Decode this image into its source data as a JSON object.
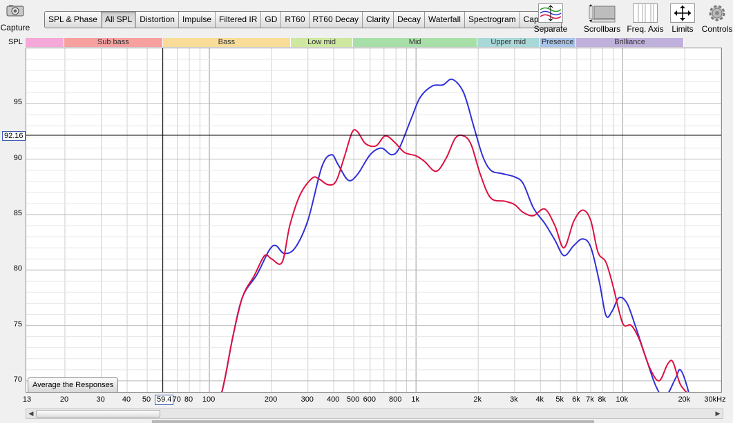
{
  "capture": {
    "label": "Capture",
    "icon": "camera-icon"
  },
  "tabs": [
    {
      "label": "SPL & Phase",
      "active": false
    },
    {
      "label": "All SPL",
      "active": true
    },
    {
      "label": "Distortion",
      "active": false
    },
    {
      "label": "Impulse",
      "active": false
    },
    {
      "label": "Filtered IR",
      "active": false
    },
    {
      "label": "GD",
      "active": false
    },
    {
      "label": "RT60",
      "active": false
    },
    {
      "label": "RT60 Decay",
      "active": false
    },
    {
      "label": "Clarity",
      "active": false
    },
    {
      "label": "Decay",
      "active": false
    },
    {
      "label": "Waterfall",
      "active": false
    },
    {
      "label": "Spectrogram",
      "active": false
    },
    {
      "label": "Captured",
      "active": false
    }
  ],
  "toolbar": {
    "separate": "Separate",
    "scrollbars": "Scrollbars",
    "freq_axis": "Freq. Axis",
    "limits": "Limits",
    "controls": "Controls"
  },
  "spl_label": "SPL",
  "bands": [
    {
      "label": "",
      "from": 13,
      "to": 20,
      "color": "#f6a8d8"
    },
    {
      "label": "Sub bass",
      "from": 20,
      "to": 60,
      "color": "#f6a0a0"
    },
    {
      "label": "Bass",
      "from": 60,
      "to": 250,
      "color": "#f8dc98"
    },
    {
      "label": "Low mid",
      "from": 250,
      "to": 500,
      "color": "#cfe8a0"
    },
    {
      "label": "Mid",
      "from": 500,
      "to": 2000,
      "color": "#a8dfa8"
    },
    {
      "label": "Upper mid",
      "from": 2000,
      "to": 4000,
      "color": "#a8d8d8"
    },
    {
      "label": "Presence",
      "from": 4000,
      "to": 6000,
      "color": "#a8c4e8"
    },
    {
      "label": "Brilliance",
      "from": 6000,
      "to": 20000,
      "color": "#c0b0dc"
    }
  ],
  "cursor": {
    "y_readout": "92.16",
    "x_readout": "59.4",
    "y_value": 92.16,
    "x_value": 59.4
  },
  "average_button": "Average the Responses",
  "chart_data": {
    "type": "line",
    "xscale": "log",
    "xlim": [
      13,
      30000
    ],
    "ylim": [
      69,
      100
    ],
    "yticks": [
      70,
      75,
      80,
      85,
      90,
      95
    ],
    "xticks": [
      {
        "v": 13,
        "label": "13"
      },
      {
        "v": 20,
        "label": "20"
      },
      {
        "v": 30,
        "label": "30"
      },
      {
        "v": 40,
        "label": "40"
      },
      {
        "v": 50,
        "label": "50"
      },
      {
        "v": 70,
        "label": "70"
      },
      {
        "v": 80,
        "label": "80"
      },
      {
        "v": 100,
        "label": "100"
      },
      {
        "v": 200,
        "label": "200"
      },
      {
        "v": 300,
        "label": "300"
      },
      {
        "v": 400,
        "label": "400"
      },
      {
        "v": 500,
        "label": "500"
      },
      {
        "v": 600,
        "label": "600"
      },
      {
        "v": 800,
        "label": "800"
      },
      {
        "v": 1000,
        "label": "1k"
      },
      {
        "v": 2000,
        "label": "2k"
      },
      {
        "v": 3000,
        "label": "3k"
      },
      {
        "v": 4000,
        "label": "4k"
      },
      {
        "v": 5000,
        "label": "5k"
      },
      {
        "v": 6000,
        "label": "6k"
      },
      {
        "v": 7000,
        "label": "7k"
      },
      {
        "v": 8000,
        "label": "8k"
      },
      {
        "v": 10000,
        "label": "10k"
      },
      {
        "v": 20000,
        "label": "20k"
      },
      {
        "v": 30000,
        "label": "30kHz"
      }
    ],
    "grid": true,
    "series": [
      {
        "color": "#3030d8",
        "points": [
          [
            100,
            66
          ],
          [
            115,
            69
          ],
          [
            130,
            74
          ],
          [
            145,
            77.6
          ],
          [
            170,
            79.6
          ],
          [
            195,
            81.8
          ],
          [
            210,
            82.2
          ],
          [
            230,
            81.5
          ],
          [
            260,
            82.0
          ],
          [
            300,
            84.5
          ],
          [
            350,
            89.3
          ],
          [
            390,
            90.4
          ],
          [
            420,
            89.5
          ],
          [
            470,
            88.1
          ],
          [
            520,
            88.6
          ],
          [
            600,
            90.4
          ],
          [
            680,
            91.0
          ],
          [
            760,
            90.4
          ],
          [
            830,
            91.0
          ],
          [
            950,
            93.7
          ],
          [
            1050,
            95.6
          ],
          [
            1200,
            96.6
          ],
          [
            1350,
            96.7
          ],
          [
            1500,
            97.2
          ],
          [
            1700,
            96.0
          ],
          [
            1900,
            93.0
          ],
          [
            2100,
            90.3
          ],
          [
            2300,
            89.0
          ],
          [
            2600,
            88.7
          ],
          [
            3000,
            88.4
          ],
          [
            3300,
            87.8
          ],
          [
            3700,
            85.6
          ],
          [
            4200,
            84.2
          ],
          [
            4700,
            82.7
          ],
          [
            5200,
            81.3
          ],
          [
            5800,
            82.2
          ],
          [
            6400,
            82.8
          ],
          [
            7000,
            82.1
          ],
          [
            7700,
            79.0
          ],
          [
            8300,
            75.9
          ],
          [
            8900,
            76.3
          ],
          [
            9600,
            77.5
          ],
          [
            10500,
            77.0
          ],
          [
            11500,
            75.0
          ],
          [
            13000,
            72.0
          ],
          [
            14500,
            69.5
          ],
          [
            16000,
            68.5
          ],
          [
            18000,
            70.2
          ],
          [
            19000,
            71.0
          ],
          [
            20500,
            69.5
          ],
          [
            22000,
            67
          ]
        ]
      },
      {
        "color": "#dd1040",
        "points": [
          [
            100,
            66
          ],
          [
            115,
            69
          ],
          [
            130,
            74
          ],
          [
            145,
            77.6
          ],
          [
            165,
            79.5
          ],
          [
            185,
            81.3
          ],
          [
            200,
            81.0
          ],
          [
            225,
            80.7
          ],
          [
            245,
            84.0
          ],
          [
            275,
            86.8
          ],
          [
            315,
            88.3
          ],
          [
            340,
            88.2
          ],
          [
            375,
            87.7
          ],
          [
            410,
            88.0
          ],
          [
            450,
            90.2
          ],
          [
            490,
            92.4
          ],
          [
            520,
            92.5
          ],
          [
            570,
            91.4
          ],
          [
            640,
            91.2
          ],
          [
            710,
            92.1
          ],
          [
            790,
            91.5
          ],
          [
            880,
            90.6
          ],
          [
            1000,
            90.3
          ],
          [
            1100,
            89.8
          ],
          [
            1250,
            88.9
          ],
          [
            1400,
            90.1
          ],
          [
            1550,
            91.9
          ],
          [
            1700,
            92.1
          ],
          [
            1850,
            91.3
          ],
          [
            2050,
            88.6
          ],
          [
            2300,
            86.5
          ],
          [
            2700,
            86.2
          ],
          [
            3000,
            85.9
          ],
          [
            3300,
            85.2
          ],
          [
            3700,
            84.9
          ],
          [
            4200,
            85.5
          ],
          [
            4700,
            84.0
          ],
          [
            5200,
            82.0
          ],
          [
            5800,
            84.4
          ],
          [
            6400,
            85.4
          ],
          [
            7000,
            84.5
          ],
          [
            7600,
            81.6
          ],
          [
            8300,
            80.7
          ],
          [
            9000,
            78.5
          ],
          [
            10000,
            75.2
          ],
          [
            11000,
            75.0
          ],
          [
            12000,
            73.8
          ],
          [
            13500,
            71.2
          ],
          [
            15000,
            70.0
          ],
          [
            16500,
            71.5
          ],
          [
            17500,
            71.7
          ],
          [
            19000,
            69.7
          ],
          [
            21000,
            68.6
          ],
          [
            22000,
            67
          ]
        ]
      }
    ]
  }
}
